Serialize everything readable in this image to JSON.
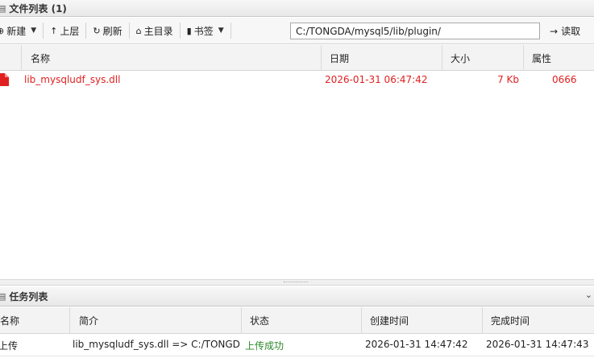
{
  "file_panel": {
    "title": "文件列表 (1)"
  },
  "toolbar": {
    "new_label": "新建",
    "up_label": "上层",
    "refresh_label": "刷新",
    "home_label": "主目录",
    "bookmark_label": "书签",
    "path_value": "C:/TONGDA/mysql5/lib/plugin/",
    "read_label": "读取"
  },
  "file_table": {
    "columns": [
      "名称",
      "日期",
      "大小",
      "属性"
    ],
    "rows": [
      {
        "name": "lib_mysqludf_sys.dll",
        "date": "2026-01-31 06:47:42",
        "size": "7 Kb",
        "perm": "0666"
      }
    ]
  },
  "task_panel": {
    "title": "任务列表",
    "columns": [
      "名称",
      "简介",
      "状态",
      "创建时间",
      "完成时间"
    ],
    "rows": [
      {
        "name": "上传",
        "desc": "lib_mysqludf_sys.dll => C:/TONGDA",
        "status": "上传成功",
        "created": "2026-01-31 14:47:42",
        "finished": "2026-01-31 14:47:43"
      }
    ]
  },
  "colors": {
    "file_text": "#e02020",
    "status_success": "#2a8a2a"
  }
}
